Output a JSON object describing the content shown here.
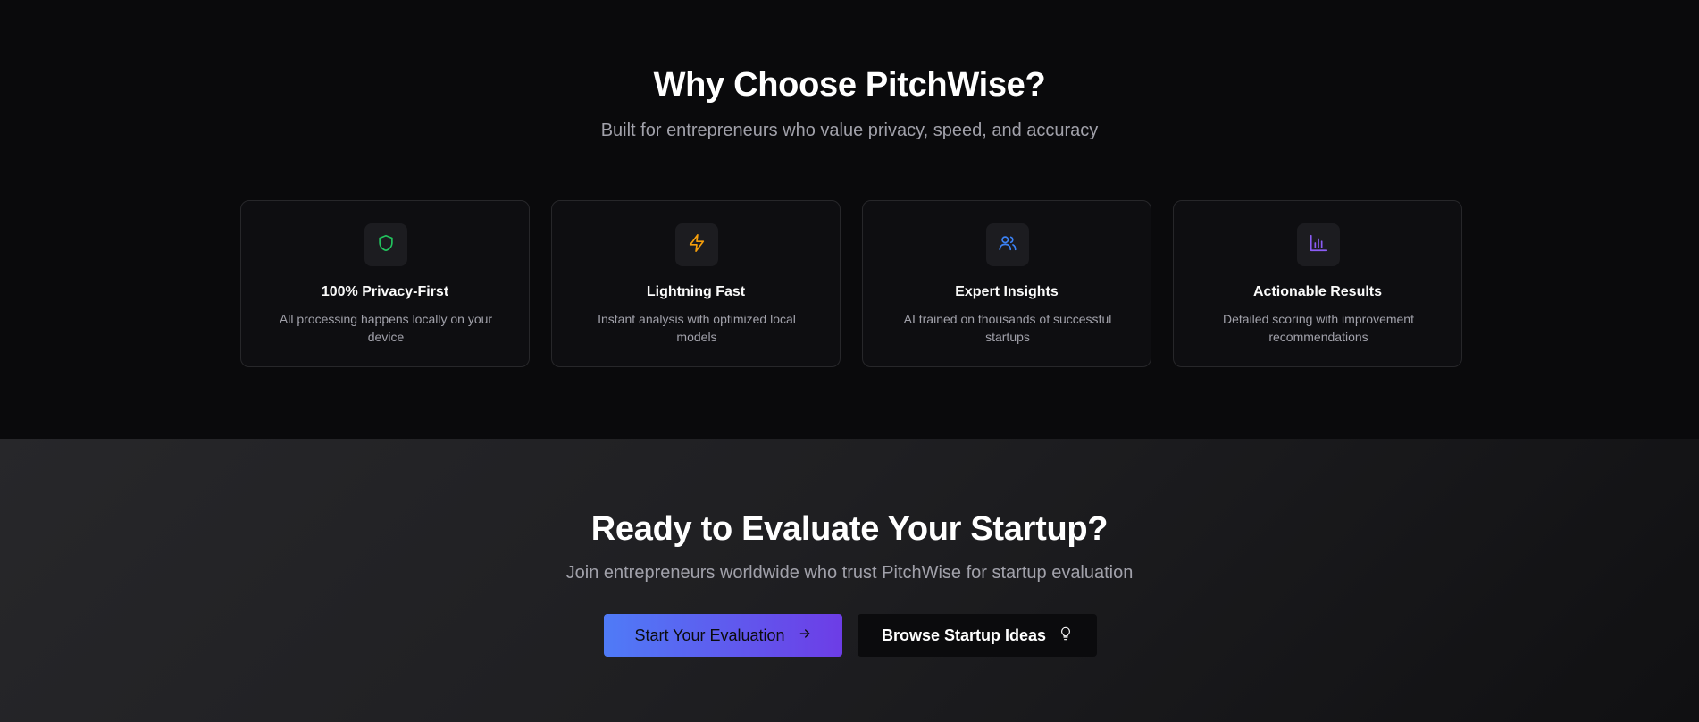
{
  "why": {
    "title": "Why Choose PitchWise?",
    "subtitle": "Built for entrepreneurs who value privacy, speed, and accuracy"
  },
  "features": [
    {
      "icon": "shield-icon",
      "icon_color": "#22c55e",
      "title": "100% Privacy-First",
      "description": "All processing happens locally on your device"
    },
    {
      "icon": "zap-icon",
      "icon_color": "#f59e0b",
      "title": "Lightning Fast",
      "description": "Instant analysis with optimized local models"
    },
    {
      "icon": "users-icon",
      "icon_color": "#3b82f6",
      "title": "Expert Insights",
      "description": "AI trained on thousands of successful startups"
    },
    {
      "icon": "bar-chart-icon",
      "icon_color": "#8b5cf6",
      "title": "Actionable Results",
      "description": "Detailed scoring with improvement recommendations"
    }
  ],
  "cta": {
    "title": "Ready to Evaluate Your Startup?",
    "subtitle": "Join entrepreneurs worldwide who trust PitchWise for startup evaluation",
    "primary_button": "Start Your Evaluation",
    "primary_icon": "arrow-right-icon",
    "secondary_button": "Browse Startup Ideas",
    "secondary_icon": "lightbulb-icon"
  },
  "colors": {
    "background": "#0a0a0c",
    "cta_background": "#27272a",
    "primary_gradient_start": "#4f7bf7",
    "primary_gradient_end": "#6d3de6"
  }
}
